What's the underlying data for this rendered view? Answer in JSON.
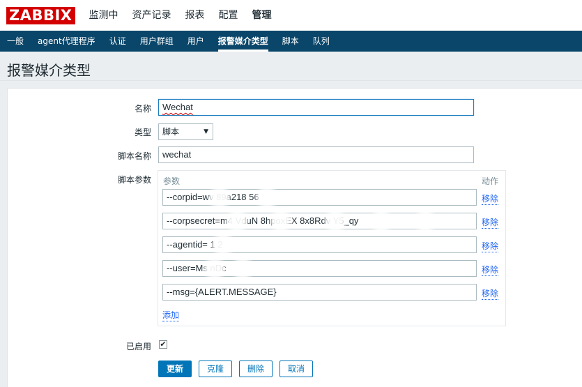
{
  "topbar": {
    "logo": "ZABBIX",
    "menu": [
      "监测中",
      "资产记录",
      "报表",
      "配置",
      "管理"
    ]
  },
  "subbar": {
    "items": [
      "一般",
      "agent代理程序",
      "认证",
      "用户群组",
      "用户",
      "报警媒介类型",
      "脚本",
      "队列"
    ]
  },
  "page_title": "报警媒介类型",
  "form": {
    "name_label": "名称",
    "name_value": "Wechat",
    "type_label": "类型",
    "type_value": "脚本",
    "script_name_label": "脚本名称",
    "script_name_value": "wechat",
    "script_params_label": "脚本参数",
    "params_header": "参数",
    "action_header": "动作",
    "params": [
      {
        "value": "--corpid=wv      89a218       56",
        "remove": "移除"
      },
      {
        "value": "--corpsecret=m4      VduN      8hpoxEX       8x8Rdv       Y5_qy",
        "remove": "移除"
      },
      {
        "value": "--agentid= 1        2",
        "remove": "移除"
      },
      {
        "value": "--user=Ms      nDc",
        "remove": "移除"
      },
      {
        "value": "--msg={ALERT.MESSAGE}",
        "remove": "移除"
      }
    ],
    "add_link": "添加",
    "enabled_label": "已启用",
    "enabled_checked": "✔"
  },
  "buttons": {
    "update": "更新",
    "clone": "克隆",
    "delete": "删除",
    "cancel": "取消"
  },
  "colors": {
    "logo_red": "#d40000",
    "subnav_blue": "#0a466a",
    "link_blue": "#1f65f4",
    "primary_button": "#0275b8"
  }
}
